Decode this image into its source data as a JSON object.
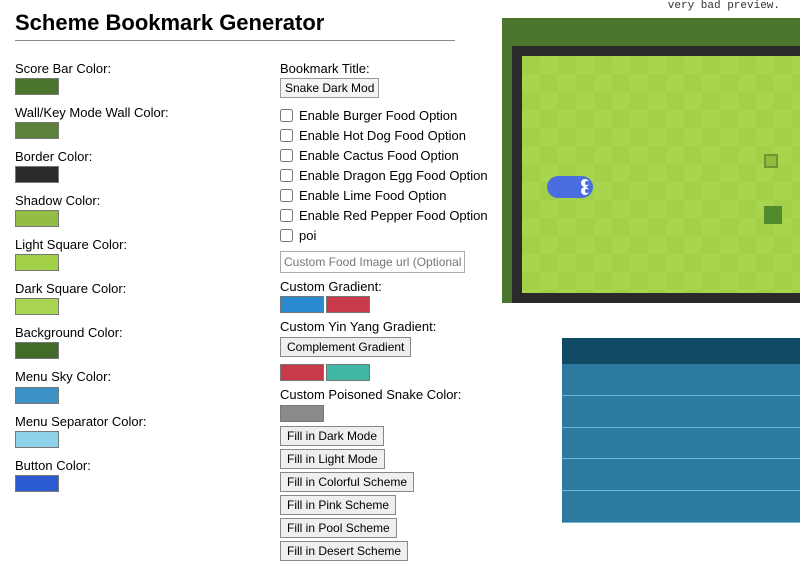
{
  "top_note": "very bad preview.",
  "page_title": "Scheme Bookmark Generator",
  "left_fields": [
    {
      "label": "Score Bar Color:",
      "color": "#4a752c"
    },
    {
      "label": "Wall/Key Mode Wall Color:",
      "color": "#5c8138"
    },
    {
      "label": "Border Color:",
      "color": "#2a2a2a"
    },
    {
      "label": "Shadow Color:",
      "color": "#94bd46"
    },
    {
      "label": "Light Square Color:",
      "color": "#a2d149"
    },
    {
      "label": "Dark Square Color:",
      "color": "#aad751"
    },
    {
      "label": "Background Color:",
      "color": "#426b29"
    },
    {
      "label": "Menu Sky Color:",
      "color": "#3b93c5"
    },
    {
      "label": "Menu Separator Color:",
      "color": "#8fd1e8"
    },
    {
      "label": "Button Color:",
      "color": "#2c5bd1"
    }
  ],
  "bookmark_title_label": "Bookmark Title:",
  "bookmark_title_value": "Snake Dark Mod",
  "checkbox_options": [
    "Enable Burger Food Option",
    "Enable Hot Dog Food Option",
    "Enable Cactus Food Option",
    "Enable Dragon Egg Food Option",
    "Enable Lime Food Option",
    "Enable Red Pepper Food Option",
    "poi"
  ],
  "custom_food_placeholder": "Custom Food Image url (Optional)",
  "custom_gradient_label": "Custom Gradient:",
  "gradient_colors": [
    "#2c8ad1",
    "#c83a4a"
  ],
  "yin_yang_label": "Custom Yin Yang Gradient:",
  "yin_yang_colors": [
    "#c83a4a",
    "#41b8a5"
  ],
  "complement_button": "Complement Gradient",
  "poisoned_label": "Custom Poisoned Snake Color:",
  "poisoned_color": "#8a8a8a",
  "fill_buttons": [
    "Fill in Dark Mode",
    "Fill in Light Mode",
    "Fill in Colorful Scheme",
    "Fill in Pink Scheme",
    "Fill in Pool Scheme",
    "Fill in Desert Scheme"
  ]
}
